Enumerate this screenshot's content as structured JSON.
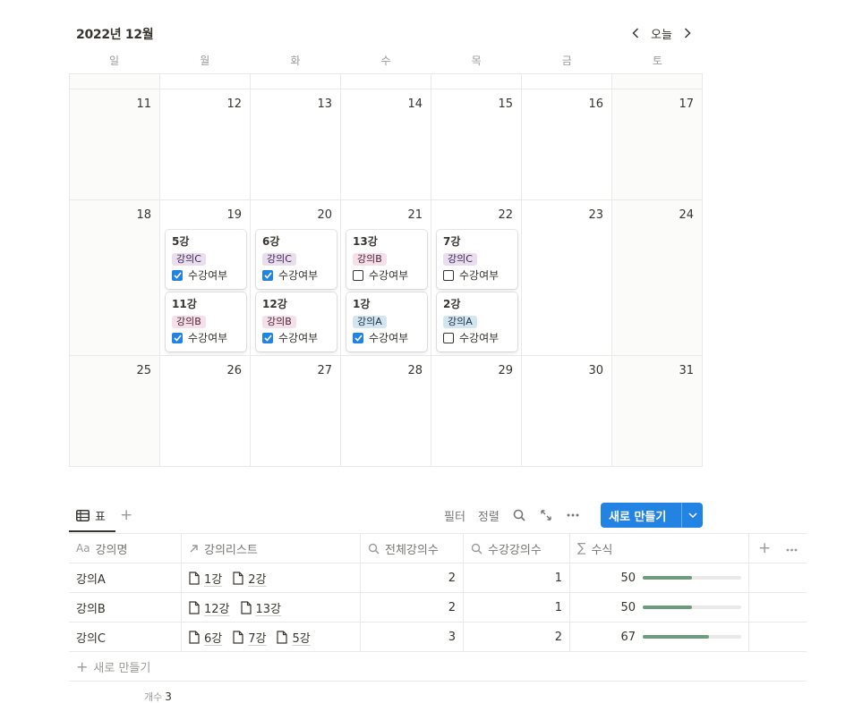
{
  "calendar": {
    "title": "2022년 12월",
    "today_label": "오늘",
    "weekdays": [
      "일",
      "월",
      "화",
      "수",
      "목",
      "금",
      "토"
    ],
    "weeks": [
      {
        "days": [
          "",
          "",
          "",
          "",
          "",
          "",
          ""
        ]
      },
      {
        "days": [
          "11",
          "12",
          "13",
          "14",
          "15",
          "16",
          "17"
        ]
      },
      {
        "days": [
          "18",
          "19",
          "20",
          "21",
          "22",
          "23",
          "24"
        ]
      },
      {
        "days": [
          "25",
          "26",
          "27",
          "28",
          "29",
          "30",
          "31"
        ]
      }
    ],
    "events": {
      "d19": [
        {
          "title": "5강",
          "tag": "강의C",
          "tag_color": "purple",
          "check_label": "수강여부",
          "checked": true
        },
        {
          "title": "11강",
          "tag": "강의B",
          "tag_color": "pink",
          "check_label": "수강여부",
          "checked": true
        }
      ],
      "d20": [
        {
          "title": "6강",
          "tag": "강의C",
          "tag_color": "purple",
          "check_label": "수강여부",
          "checked": true
        },
        {
          "title": "12강",
          "tag": "강의B",
          "tag_color": "pink",
          "check_label": "수강여부",
          "checked": true
        }
      ],
      "d21": [
        {
          "title": "13강",
          "tag": "강의B",
          "tag_color": "pink",
          "check_label": "수강여부",
          "checked": false
        },
        {
          "title": "1강",
          "tag": "강의A",
          "tag_color": "blue",
          "check_label": "수강여부",
          "checked": true
        }
      ],
      "d22": [
        {
          "title": "7강",
          "tag": "강의C",
          "tag_color": "purple",
          "check_label": "수강여부",
          "checked": false
        },
        {
          "title": "2강",
          "tag": "강의A",
          "tag_color": "blue",
          "check_label": "수강여부",
          "checked": false
        }
      ]
    }
  },
  "table_view": {
    "tab_label": "표",
    "filter_label": "필터",
    "sort_label": "정렬",
    "new_button_label": "새로 만들기",
    "columns": [
      {
        "icon": "Aa",
        "label": "강의명"
      },
      {
        "icon": "relation-icon",
        "label": "강의리스트"
      },
      {
        "icon": "search-icon",
        "label": "전체강의수"
      },
      {
        "icon": "search-icon",
        "label": "수강강의수"
      },
      {
        "icon": "sigma-icon",
        "label": "수식"
      }
    ],
    "rows": [
      {
        "name": "강의A",
        "links": [
          "1강",
          "2강"
        ],
        "total": "2",
        "taken": "1",
        "formula": "50",
        "progress": 0.5
      },
      {
        "name": "강의B",
        "links": [
          "12강",
          "13강"
        ],
        "total": "2",
        "taken": "1",
        "formula": "50",
        "progress": 0.5
      },
      {
        "name": "강의C",
        "links": [
          "6강",
          "7강",
          "5강"
        ],
        "total": "3",
        "taken": "2",
        "formula": "67",
        "progress": 0.67
      }
    ],
    "new_row_label": "새로 만들기",
    "count_label": "개수",
    "count_value": "3"
  },
  "colors": {
    "accent": "#2383e2",
    "progress": "#6c9b7d",
    "tag_purple": "#e8deee",
    "tag_pink": "#f5e0e9",
    "tag_blue": "#d3e5ef"
  }
}
